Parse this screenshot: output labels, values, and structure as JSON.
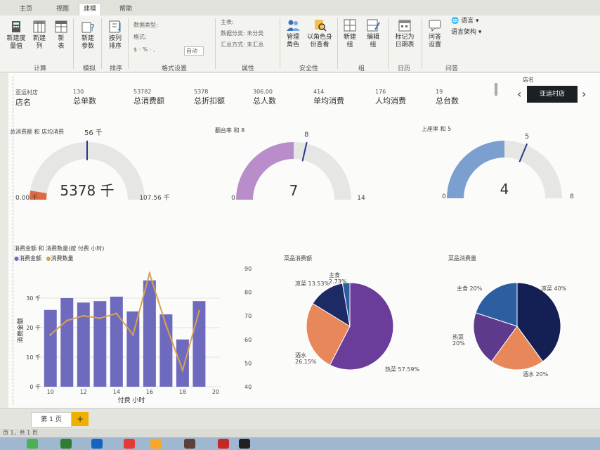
{
  "tabs": [
    "主页",
    "视图",
    "建模",
    "帮助"
  ],
  "ribbon": {
    "buttons": [
      {
        "label": "新建度\n量值"
      },
      {
        "label": "新建\n列"
      },
      {
        "label": "新\n表"
      },
      {
        "label": "新建\n参数"
      },
      {
        "label": "按列\n排序"
      },
      {
        "label": "管理\n角色"
      },
      {
        "label": "以角色身\n份查看"
      },
      {
        "label": "新建\n组"
      },
      {
        "label": "编辑\n组"
      },
      {
        "label": "标记为\n日期表"
      },
      {
        "label": "问答\n设置"
      }
    ],
    "format_items": {
      "data_type": "数据类型:",
      "format": "格式:",
      "currency": "$ · % · ,",
      "auto": "自动",
      "home_table": "主表:",
      "data_category": "数据分类: 未分类",
      "summarize": "汇总方式: 未汇总",
      "language": "语言",
      "linguistic_schema": "语言架构"
    },
    "groups": [
      "计算",
      "模拟",
      "排序",
      "格式设置",
      "属性",
      "安全性",
      "组",
      "日历",
      "问答"
    ]
  },
  "kpis": [
    {
      "value": "亚运村店",
      "label": "店名"
    },
    {
      "value": "130",
      "label": "总单数"
    },
    {
      "value": "53782",
      "label": "总消费额"
    },
    {
      "value": "5378",
      "label": "总折扣额"
    },
    {
      "value": "306.00",
      "label": "总人数"
    },
    {
      "value": "414",
      "label": "单均消费"
    },
    {
      "value": "176",
      "label": "人均消费"
    },
    {
      "value": "19",
      "label": "总台数"
    }
  ],
  "slicer": {
    "title": "店名",
    "selected": "亚运村店",
    "prev": "‹",
    "next": "›"
  },
  "gauges": [
    {
      "title": "总消费额 和 店均消费",
      "value_text": "5378 千",
      "min_text": "0.00 千",
      "max_text": "107.56 千",
      "target_text": "56 千",
      "value": 5378,
      "min": 0,
      "max": 107560,
      "target": 53780,
      "color": "#e0693f"
    },
    {
      "title": "翻台率 和 8",
      "value_text": "7",
      "min_text": "0",
      "max_text": "14",
      "target_text": "8",
      "value": 7,
      "min": 0,
      "max": 14,
      "target": 8,
      "color": "#b98dc9"
    },
    {
      "title": "上座率 和 5",
      "value_text": "4",
      "min_text": "0",
      "max_text": "8",
      "target_text": "5",
      "value": 4,
      "min": 0,
      "max": 8,
      "target": 5,
      "color": "#7ba0d0"
    }
  ],
  "combo": {
    "title": "消费金额 和 消费数量(按 付费 小时)",
    "legend": [
      "消费金额",
      "消费数量"
    ],
    "colors": [
      "#6e6bbf",
      "#d7a24e"
    ]
  },
  "pies": [
    {
      "title": "菜品消费额"
    },
    {
      "title": "菜品消费量"
    }
  ],
  "chart_data": [
    {
      "type": "bar",
      "title": "消费金额 和 消费数量(按 付费 小时)",
      "xlabel": "付费 小时",
      "ylabel": "消费金额",
      "x": [
        10,
        11,
        12,
        13,
        14,
        15,
        16,
        17,
        18,
        19
      ],
      "xticks": [
        "10",
        "12",
        "14",
        "16",
        "18",
        "20"
      ],
      "ylim": [
        0,
        40000
      ],
      "yticks": [
        "0 千",
        "10 千",
        "20 千",
        "30 千"
      ],
      "y2lim": [
        40,
        90
      ],
      "y2ticks": [
        "40",
        "50",
        "60",
        "70",
        "80",
        "90"
      ],
      "series": [
        {
          "name": "消费金额",
          "type": "bar",
          "values": [
            26000,
            30000,
            28500,
            29000,
            30500,
            25500,
            36000,
            24500,
            16000,
            29000
          ]
        },
        {
          "name": "消费数量",
          "type": "line",
          "values": [
            62,
            68,
            70,
            69,
            71,
            62,
            88,
            66,
            47,
            72
          ]
        }
      ]
    },
    {
      "type": "pie",
      "title": "菜品消费额",
      "labels": [
        "热菜",
        "酒水",
        "凉菜",
        "主食"
      ],
      "label_texts": [
        "热菜 57.59%",
        "酒水\n26.15%",
        "凉菜 13.53%",
        "主食\n2.73%"
      ],
      "values": [
        57.59,
        26.15,
        13.53,
        2.73
      ],
      "colors": [
        "#6a3d9a",
        "#e8875a",
        "#1c2a66",
        "#2d5fa0"
      ]
    },
    {
      "type": "pie",
      "title": "菜品消费量",
      "labels": [
        "凉菜",
        "酒水",
        "热菜",
        "主食"
      ],
      "label_texts": [
        "凉菜 40%",
        "酒水 20%",
        "热菜\n20%",
        "主食 20%"
      ],
      "values": [
        40,
        20,
        20,
        20
      ],
      "colors": [
        "#142054",
        "#e8875a",
        "#5e3a8c",
        "#2d5fa0"
      ]
    }
  ],
  "sheet": {
    "tab": "第 1 页",
    "add": "+",
    "status": "页 1，共 1 页"
  }
}
